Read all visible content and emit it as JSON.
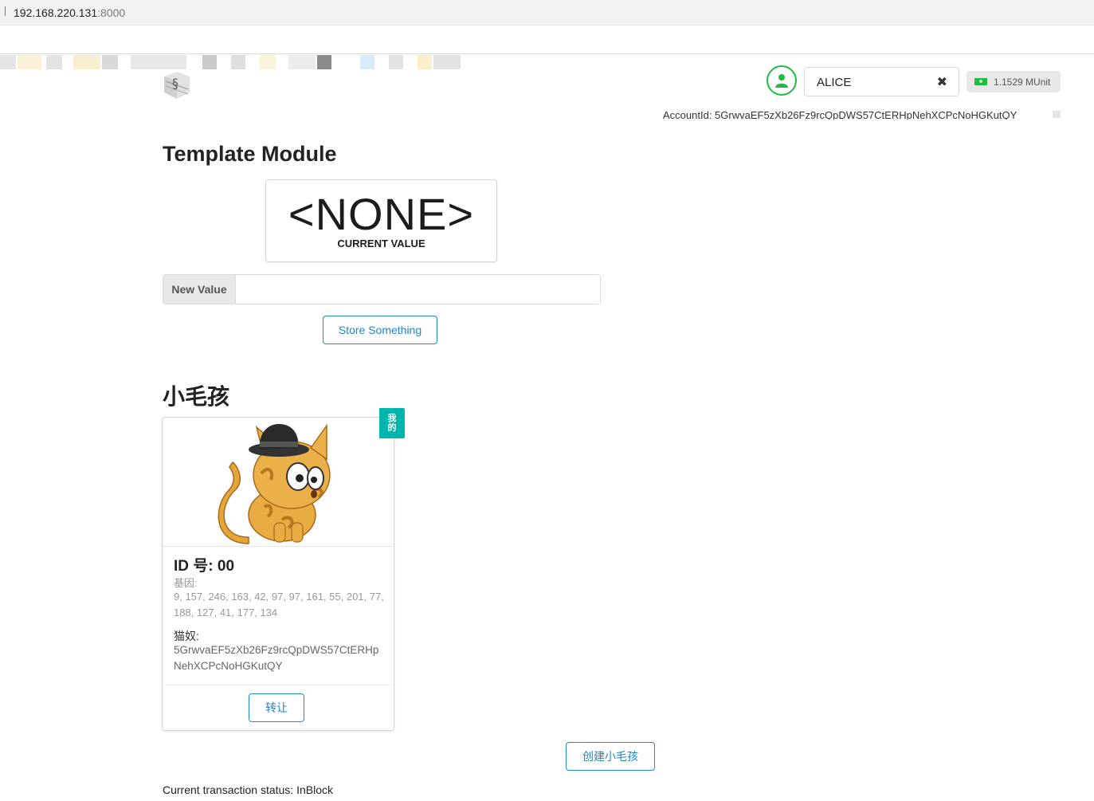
{
  "browser": {
    "url_host": "192.168.220.131",
    "url_port": ":8000"
  },
  "header": {
    "account_name": "ALICE",
    "balance": "1.1529 MUnit",
    "account_id": "AccountId: 5GrwvaEF5zXb26Fz9rcQpDWS57CtERHpNehXCPcNoHGKutQY",
    "icons": [
      "substrate-logo-icon",
      "user-icon",
      "clear-icon",
      "money-icon",
      "copy-icon"
    ],
    "colors": {
      "user_icon": "#21ba45",
      "balance_bg": "#e8e8e8"
    }
  },
  "template_module": {
    "title": "Template Module",
    "current_value": "<NONE>",
    "current_value_label": "CURRENT VALUE",
    "input_label": "New Value",
    "input_value": "",
    "store_button": "Store Something"
  },
  "kitties": {
    "title": "小毛孩",
    "items": [
      {
        "ribbon": "我的",
        "id_text": "ID 号: 00",
        "dna_label": "基因:",
        "dna": "9, 157, 246, 163, 42, 97, 97, 161, 55, 201, 77, 188, 127, 41, 177, 134",
        "owner_label": "猫奴:",
        "owner": "5GrwvaEF5zXb26Fz9rcQpDWS57CtERHpNehXCPcNoHGKutQY",
        "transfer_button": "转让"
      }
    ],
    "create_button": "创建小毛孩",
    "colors": {
      "ribbon": "#00b5ad",
      "button_border": "#2185d0"
    }
  },
  "status": {
    "text": "Current transaction status: InBlock"
  }
}
